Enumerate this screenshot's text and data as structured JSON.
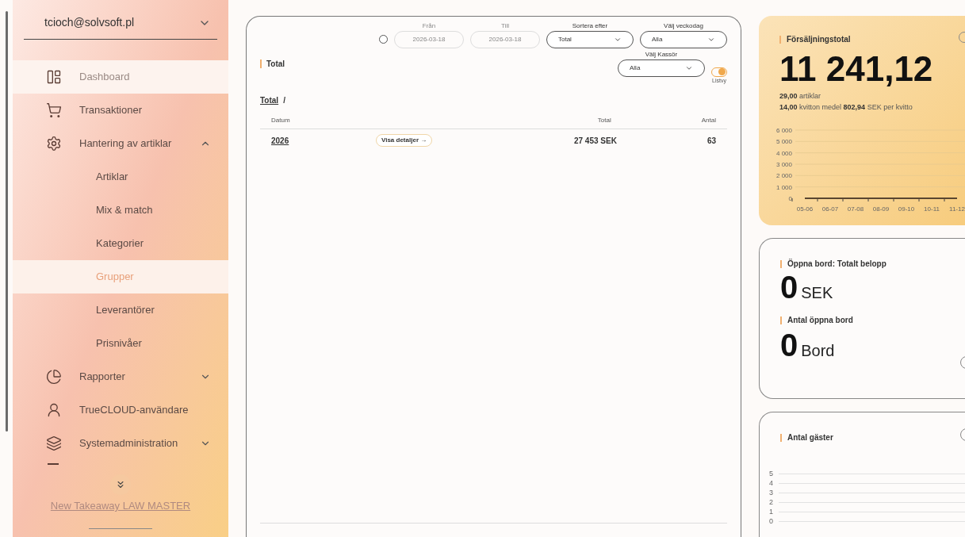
{
  "sidebar": {
    "account": "tcioch@solvsoft.pl",
    "items": [
      {
        "kind": "item",
        "label": "Dashboard",
        "selected": true
      },
      {
        "kind": "item",
        "label": "Transaktioner",
        "selected": false
      },
      {
        "kind": "group",
        "label": "Hantering av artiklar",
        "selected": false,
        "expanded": true,
        "children": [
          {
            "label": "Artiklar",
            "highlighted": false
          },
          {
            "label": "Mix & match",
            "highlighted": false
          },
          {
            "label": "Kategorier",
            "highlighted": false
          },
          {
            "label": "Grupper",
            "highlighted": true
          },
          {
            "label": "Leverantörer",
            "highlighted": false
          },
          {
            "label": "Prisnivåer",
            "highlighted": false
          }
        ]
      },
      {
        "kind": "group",
        "label": "Rapporter",
        "selected": false,
        "expanded": false
      },
      {
        "kind": "item",
        "label": "TrueCLOUD-användare",
        "selected": false
      },
      {
        "kind": "group",
        "label": "Systemadministration",
        "selected": false,
        "expanded": false
      }
    ],
    "footer_link": "New Takeaway LAW MASTER"
  },
  "main": {
    "title": "Total",
    "filters": {
      "from": {
        "label": "Från",
        "value": "2026-03-18"
      },
      "to": {
        "label": "Till",
        "value": "2026-03-18"
      },
      "date_enabled": false,
      "sort": {
        "label": "Sortera efter",
        "value": "Total"
      },
      "weekday": {
        "label": "Välj veckodag",
        "value": "Alla"
      },
      "cashier": {
        "label": "Välj Kassör",
        "value": "Alla"
      },
      "list_view": {
        "label": "Listvy",
        "on": true
      }
    },
    "breadcrumb": [
      "Total",
      "/"
    ],
    "table": {
      "columns": [
        "Datum",
        "Total",
        "Antal"
      ],
      "rows": [
        {
          "datum": "2026",
          "action": "Visa detaljer →",
          "total": "27 453 SEK",
          "antal": "63"
        }
      ]
    }
  },
  "sales": {
    "title": "Försäljningstotal",
    "amount": "11 241,12",
    "items_count": "29,00",
    "items_label": "artiklar",
    "receipts_count": "14,00",
    "receipts_text": "kvitton medel",
    "average": "802,94",
    "average_text": "SEK per kvitto",
    "chart_data": {
      "type": "line",
      "categories": [
        "05-06",
        "06-07",
        "07-08",
        "08-09",
        "09-10",
        "10-11",
        "11-12"
      ],
      "series": [
        {
          "color": "#5a4630",
          "values": [
            0,
            0,
            0,
            0,
            0,
            0,
            0
          ]
        }
      ],
      "grid": true,
      "ylim": [
        0,
        6000
      ],
      "yticks": [
        {
          "value": 0,
          "label": "0"
        },
        {
          "value": 1000,
          "label": "1 000"
        },
        {
          "value": 2000,
          "label": "2 000"
        },
        {
          "value": 3000,
          "label": "3 000"
        },
        {
          "value": 4000,
          "label": "4 000"
        },
        {
          "value": 5000,
          "label": "5 000"
        },
        {
          "value": 6000,
          "label": "6 000"
        }
      ]
    }
  },
  "open_tables": {
    "amount_title": "Öppna bord: Totalt belopp",
    "amount": "0",
    "amount_unit": "SEK",
    "count_title": "Antal öppna bord",
    "count": "0",
    "count_unit": "Bord"
  },
  "guests": {
    "title": "Antal gäster",
    "axis_labels": [
      "5",
      "4",
      "3",
      "2",
      "1",
      "0"
    ]
  }
}
